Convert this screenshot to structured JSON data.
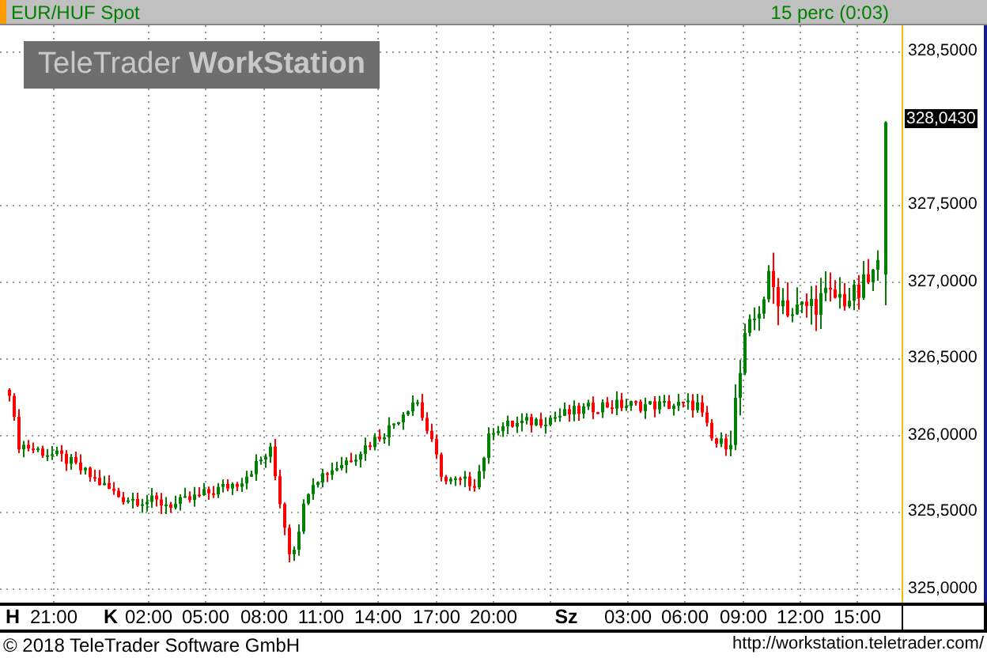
{
  "header": {
    "symbol": "EUR/HUF Spot",
    "interval": "15 perc (0:03)"
  },
  "watermark": "TeleTrader **WorkStation**",
  "price_axis": {
    "labels": [
      "328,5000",
      "327,5000",
      "327,0000",
      "326,5000",
      "326,0000",
      "325,5000",
      "325,0000"
    ],
    "last_price": "328,0430"
  },
  "time_axis": [
    {
      "text": "H",
      "kind": "day"
    },
    {
      "text": "21:00",
      "kind": "time"
    },
    {
      "text": "K",
      "kind": "day"
    },
    {
      "text": "02:00",
      "kind": "time"
    },
    {
      "text": "05:00",
      "kind": "time"
    },
    {
      "text": "08:00",
      "kind": "time"
    },
    {
      "text": "11:00",
      "kind": "time"
    },
    {
      "text": "14:00",
      "kind": "time"
    },
    {
      "text": "17:00",
      "kind": "time"
    },
    {
      "text": "20:00",
      "kind": "time"
    },
    {
      "text": "Sz",
      "kind": "day"
    },
    {
      "text": "03:00",
      "kind": "time"
    },
    {
      "text": "06:00",
      "kind": "time"
    },
    {
      "text": "09:00",
      "kind": "time"
    },
    {
      "text": "12:00",
      "kind": "time"
    },
    {
      "text": "15:00",
      "kind": "time"
    }
  ],
  "footer": {
    "copyright": "© 2018 TeleTrader Software GmbH",
    "url": "http://workstation.teletrader.com/"
  }
}
